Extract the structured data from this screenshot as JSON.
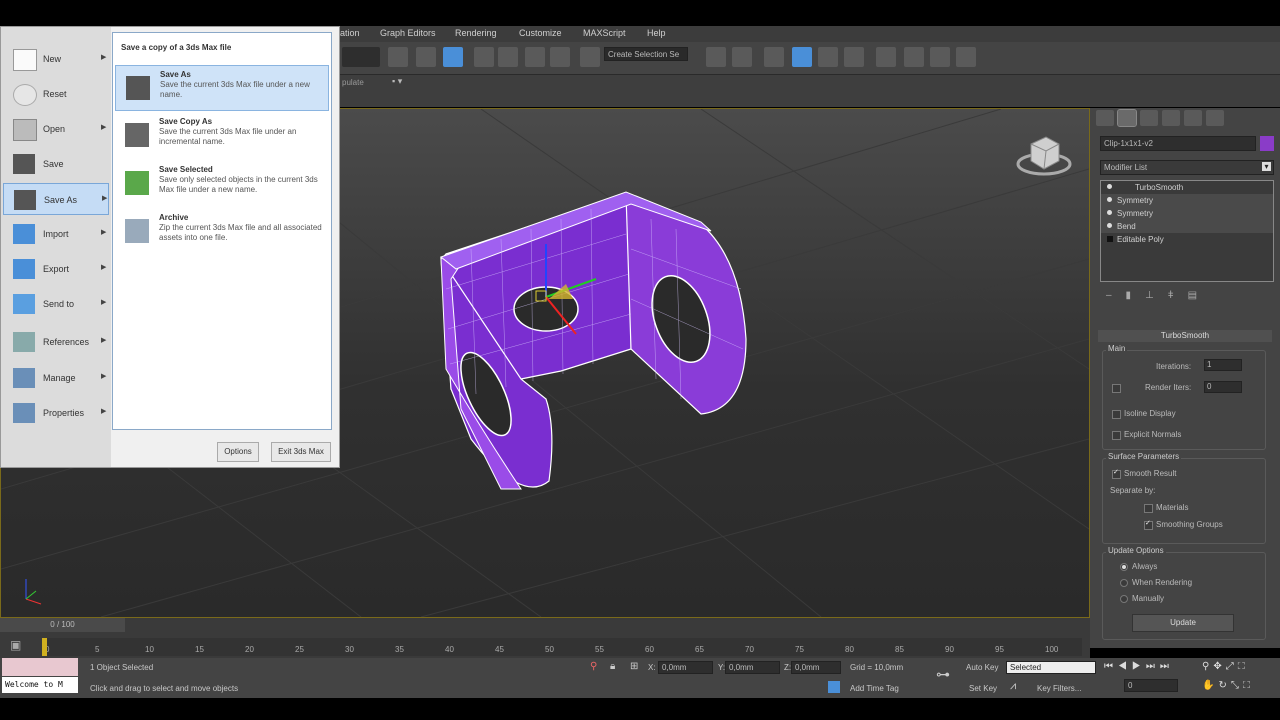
{
  "menubar": {
    "items": [
      "ation",
      "Graph Editors",
      "Rendering",
      "Customize",
      "MAXScript",
      "Help"
    ]
  },
  "toolbar": {
    "selection_set_placeholder": "Create Selection Se"
  },
  "ribbon": {
    "label": "pulate"
  },
  "app_menu": {
    "left_items": [
      {
        "label": "New"
      },
      {
        "label": "Reset"
      },
      {
        "label": "Open"
      },
      {
        "label": "Save"
      },
      {
        "label": "Save As"
      },
      {
        "label": "Import"
      },
      {
        "label": "Export"
      },
      {
        "label": "Send to"
      },
      {
        "label": "References"
      },
      {
        "label": "Manage"
      },
      {
        "label": "Properties"
      }
    ],
    "panel_header": "Save a copy of a 3ds Max file",
    "right_items": [
      {
        "title": "Save As",
        "desc": "Save the current 3ds Max file under a new name."
      },
      {
        "title": "Save Copy As",
        "desc": "Save the current 3ds Max file under an incremental name."
      },
      {
        "title": "Save Selected",
        "desc": "Save only selected objects in the current 3ds Max file under a new name."
      },
      {
        "title": "Archive",
        "desc": "Zip the current 3ds Max file and all associated assets into one file."
      }
    ],
    "options_label": "Options",
    "exit_label": "Exit 3ds Max"
  },
  "command_panel": {
    "object_name": "Clip-1x1x1-v2",
    "object_color": "#8a3cc8",
    "modifier_list": "Modifier List",
    "stack": [
      "TurboSmooth",
      "Symmetry",
      "Symmetry",
      "Bend",
      "Editable Poly"
    ],
    "rollout_title": "TurboSmooth",
    "main_group": "Main",
    "iterations_label": "Iterations:",
    "iterations_value": "1",
    "render_iters_label": "Render Iters:",
    "render_iters_value": "0",
    "isoline_label": "Isoline Display",
    "explicit_label": "Explicit Normals",
    "surface_group": "Surface Parameters",
    "smooth_result": "Smooth Result",
    "separate_by": "Separate by:",
    "materials": "Materials",
    "smoothing_groups": "Smoothing Groups",
    "update_group": "Update Options",
    "always": "Always",
    "when_rendering": "When Rendering",
    "manually": "Manually",
    "update_btn": "Update"
  },
  "timeline": {
    "frame": "0 / 100",
    "ticks": [
      "0",
      "5",
      "10",
      "15",
      "20",
      "25",
      "30",
      "35",
      "40",
      "45",
      "50",
      "55",
      "60",
      "65",
      "70",
      "75",
      "80",
      "85",
      "90",
      "95",
      "100"
    ]
  },
  "status": {
    "maxscript": "Welcome to M",
    "selected": "1 Object Selected",
    "prompt": "Click and drag to select and move objects",
    "x_label": "X:",
    "x_value": "0,0mm",
    "y_label": "Y:",
    "y_value": "0,0mm",
    "z_label": "Z:",
    "z_value": "0,0mm",
    "grid": "Grid = 10,0mm",
    "add_time_tag": "Add Time Tag",
    "auto_key": "Auto Key",
    "set_key": "Set Key",
    "key_mode": "Selected",
    "key_filters": "Key Filters...",
    "current_frame": "0"
  },
  "colors": {
    "viewport_border": "#7a6a1a",
    "mesh": "#8a3cc8",
    "highlight": "#4a8fd8"
  }
}
